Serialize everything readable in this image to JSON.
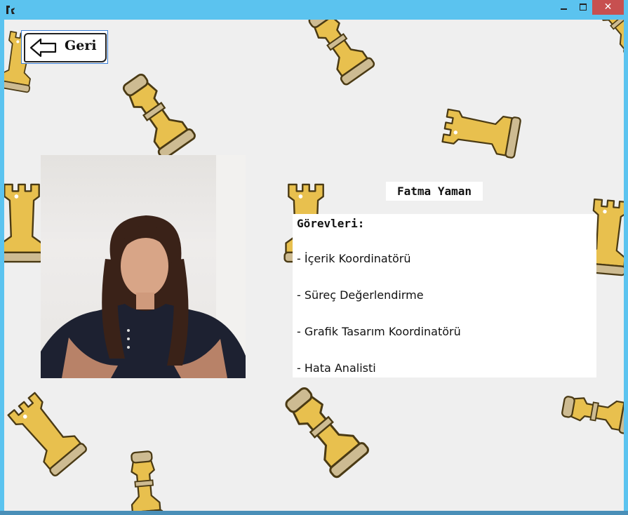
{
  "window": {
    "close_glyph": "✕"
  },
  "toolbar": {
    "back_label": "Geri"
  },
  "profile": {
    "name": "Fatma Yaman",
    "duties_heading": "Görevleri:",
    "duties": [
      "- İçerik Koordinatörü",
      "- Süreç Değerlendirme",
      "- Grafik Tasarım Koordinatörü",
      "- Hata Analisti"
    ]
  },
  "colors": {
    "titlebar": "#5bc3ef",
    "close_button": "#c75050",
    "background": "#efefef",
    "piece_gold": "#e8c04e",
    "piece_base": "#cdbb92"
  }
}
